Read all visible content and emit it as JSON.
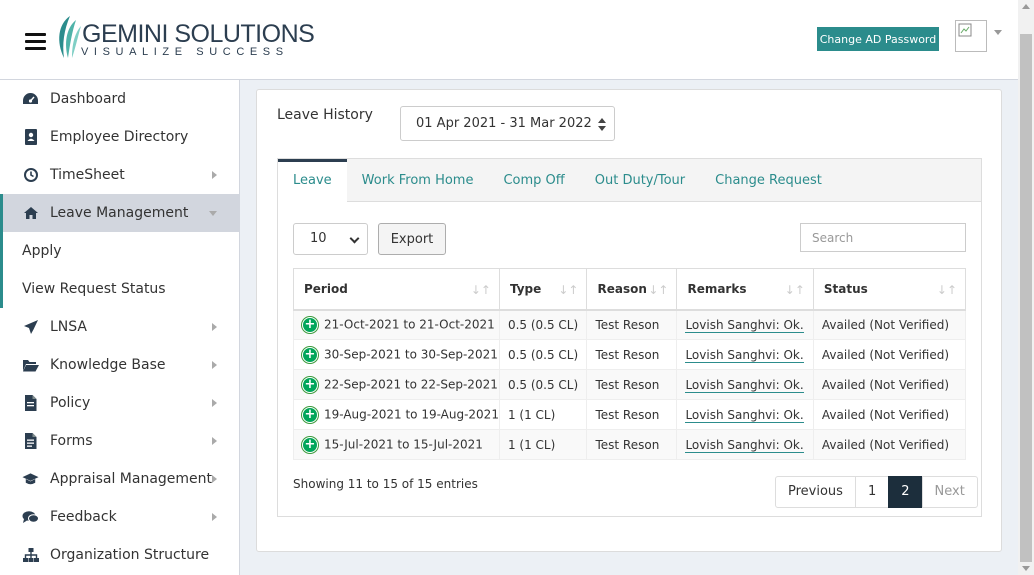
{
  "header": {
    "logo_text": "GEMINI SOLUTIONS",
    "logo_tagline": "VISUALIZE SUCCESS",
    "change_ad_password": "Change AD Password",
    "accent_color": "#2b8c8c"
  },
  "sidebar": {
    "items": [
      {
        "label": "Dashboard",
        "icon": "dashboard-icon",
        "has_arrow": false
      },
      {
        "label": "Employee Directory",
        "icon": "address-book-icon",
        "has_arrow": false
      },
      {
        "label": "TimeSheet",
        "icon": "clock-icon",
        "has_arrow": true
      },
      {
        "label": "Leave Management",
        "icon": "home-icon",
        "has_arrow": true,
        "active": true
      },
      {
        "label": "LNSA",
        "icon": "plane-icon",
        "has_arrow": true
      },
      {
        "label": "Knowledge Base",
        "icon": "folder-open-icon",
        "has_arrow": true
      },
      {
        "label": "Policy",
        "icon": "file-icon",
        "has_arrow": true
      },
      {
        "label": "Forms",
        "icon": "file-text-icon",
        "has_arrow": true
      },
      {
        "label": "Appraisal Management",
        "icon": "graduation-cap-icon",
        "has_arrow": true
      },
      {
        "label": "Feedback",
        "icon": "comments-icon",
        "has_arrow": true
      },
      {
        "label": "Organization Structure",
        "icon": "sitemap-icon",
        "has_arrow": false
      }
    ],
    "sub_items": [
      "Apply",
      "View Request Status"
    ]
  },
  "main": {
    "leave_history_label": "Leave History",
    "financial_year": "01 Apr 2021 - 31 Mar 2022",
    "tabs": [
      "Leave",
      "Work From Home",
      "Comp Off",
      "Out Duty/Tour",
      "Change Request"
    ],
    "page_length": "10",
    "export_label": "Export",
    "search_placeholder": "Search",
    "columns": [
      "Period",
      "Type",
      "Reason",
      "Remarks",
      "Status"
    ],
    "rows": [
      {
        "period": "21-Oct-2021 to 21-Oct-2021",
        "type": "0.5 (0.5 CL)",
        "reason": "Test Reson",
        "remarks": "Lovish Sanghvi: Ok.",
        "status": "Availed (Not Verified)"
      },
      {
        "period": "30-Sep-2021 to 30-Sep-2021",
        "type": "0.5 (0.5 CL)",
        "reason": "Test Reson",
        "remarks": "Lovish Sanghvi: Ok.",
        "status": "Availed (Not Verified)"
      },
      {
        "period": "22-Sep-2021 to 22-Sep-2021",
        "type": "0.5 (0.5 CL)",
        "reason": "Test Reson",
        "remarks": "Lovish Sanghvi: Ok.",
        "status": "Availed (Not Verified)"
      },
      {
        "period": "19-Aug-2021 to 19-Aug-2021",
        "type": "1 (1 CL)",
        "reason": "Test Reson",
        "remarks": "Lovish Sanghvi: Ok.",
        "status": "Availed (Not Verified)"
      },
      {
        "period": "15-Jul-2021 to 15-Jul-2021",
        "type": "1 (1 CL)",
        "reason": "Test Reson",
        "remarks": "Lovish Sanghvi: Ok.",
        "status": "Availed (Not Verified)"
      }
    ],
    "info": "Showing 11 to 15 of 15 entries",
    "pagination": {
      "previous": "Previous",
      "pages": [
        "1",
        "2"
      ],
      "current": "2",
      "next": "Next"
    }
  }
}
